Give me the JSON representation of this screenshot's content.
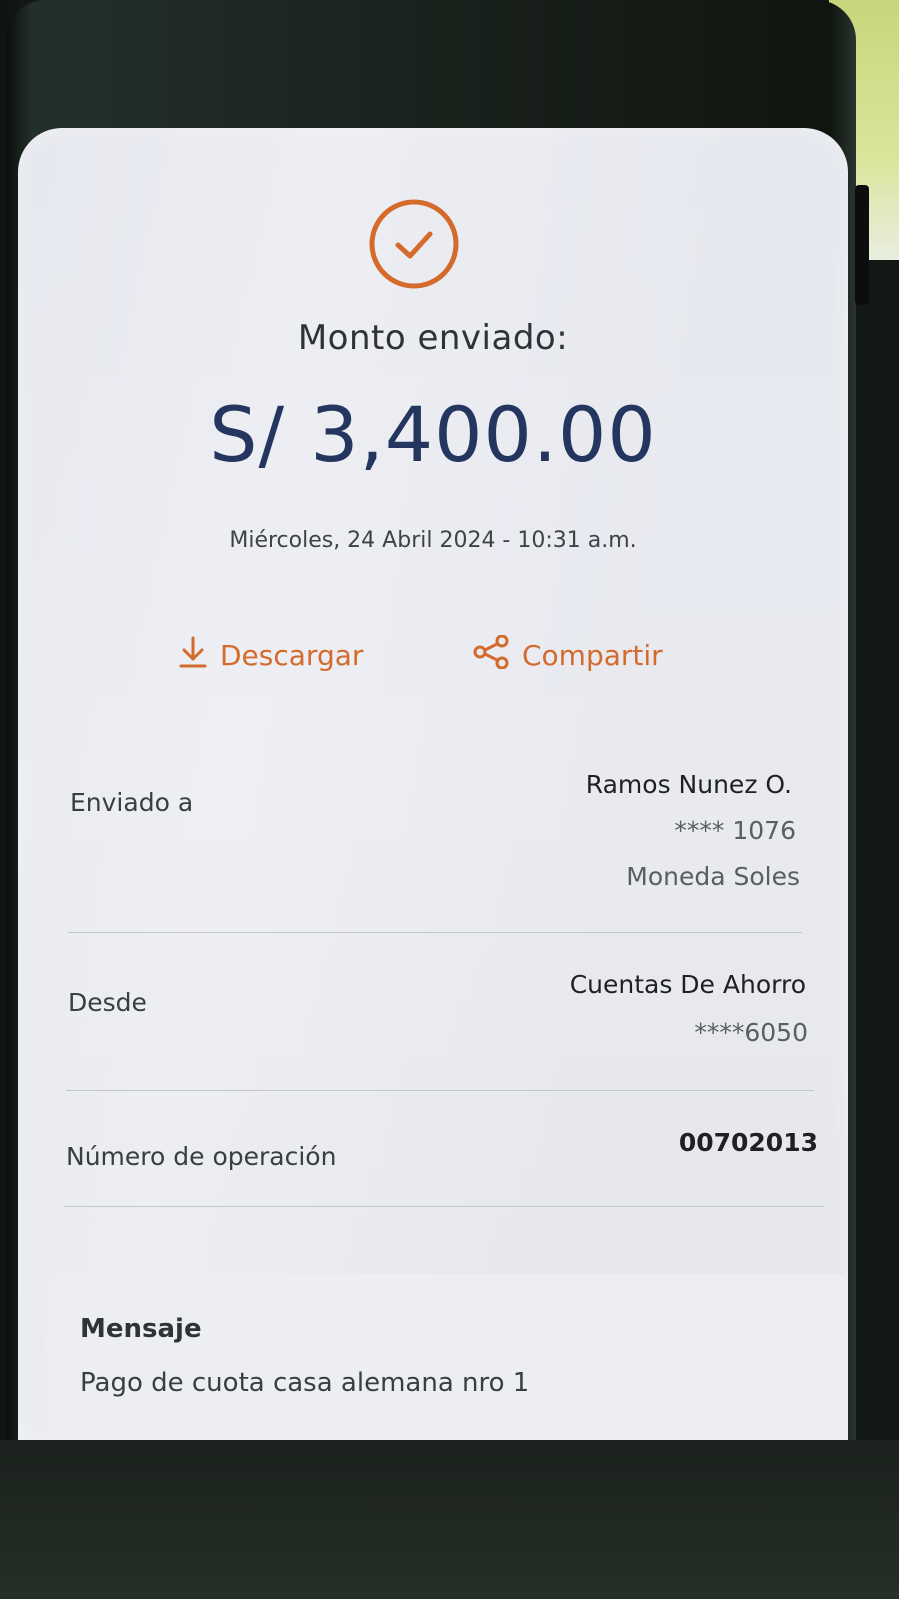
{
  "receipt": {
    "title": "Monto enviado:",
    "amount": "S/ 3,400.00",
    "datetime": "Miércoles, 24 Abril 2024 - 10:31 a.m.",
    "status_icon": "check-circle-icon",
    "accent_color": "#d46a2c",
    "amount_color": "#24355f"
  },
  "actions": {
    "download": {
      "label": "Descargar",
      "icon": "download-icon"
    },
    "share": {
      "label": "Compartir",
      "icon": "share-icon"
    }
  },
  "details": {
    "sent_to": {
      "label": "Enviado a",
      "name": "Ramos Nunez O.",
      "account": "**** 1076",
      "currency": "Moneda Soles"
    },
    "from": {
      "label": "Desde",
      "account_type": "Cuentas De Ahorro",
      "account": "****6050"
    },
    "operation": {
      "label": "Número de operación",
      "number": "00702013"
    }
  },
  "message": {
    "label": "Mensaje",
    "text": "Pago de cuota casa alemana  nro 1"
  }
}
